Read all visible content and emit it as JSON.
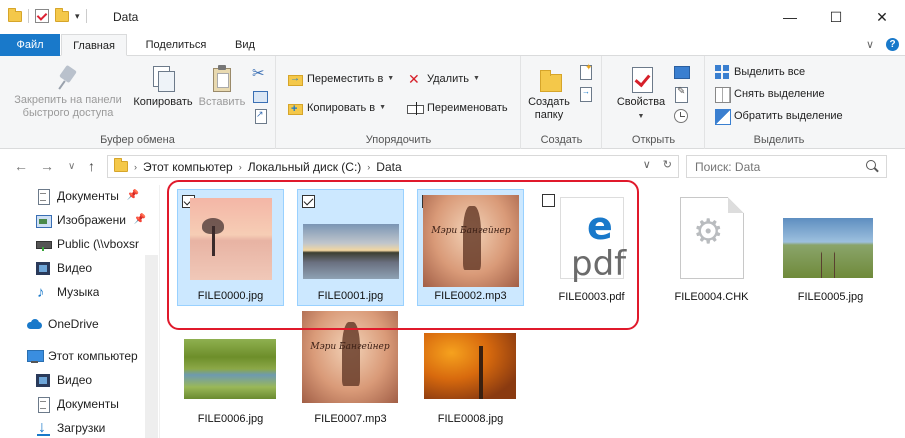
{
  "window": {
    "title": "Data",
    "controls": {
      "minimize": "—",
      "maximize": "☐",
      "close": "✕"
    }
  },
  "qat": {
    "dropdown": "▾"
  },
  "ribbon_tabs": [
    {
      "label": "Файл"
    },
    {
      "label": "Главная"
    },
    {
      "label": "Поделиться"
    },
    {
      "label": "Вид"
    }
  ],
  "ribbon_right": {
    "collapse": "∨",
    "help": "?"
  },
  "clipboard": {
    "pin": "Закрепить на панели быстрого доступа",
    "copy": "Копировать",
    "paste": "Вставить",
    "label": "Буфер обмена"
  },
  "organize": {
    "move": "Переместить в",
    "copy_to": "Копировать в",
    "delete": "Удалить",
    "rename": "Переименовать",
    "label": "Упорядочить"
  },
  "create": {
    "new_folder": "Создать папку",
    "label": "Создать"
  },
  "open": {
    "properties": "Свойства",
    "label": "Открыть"
  },
  "select": {
    "select_all": "Выделить все",
    "select_none": "Снять выделение",
    "invert": "Обратить выделение",
    "label": "Выделить"
  },
  "nav": {
    "back": "←",
    "forward": "→",
    "recent": "∨",
    "up": "↑"
  },
  "address": {
    "crumbs": [
      "Этот компьютер",
      "Локальный диск (C:)",
      "Data"
    ],
    "sep": "›",
    "dropdown": "∨",
    "refresh": "↻"
  },
  "search": {
    "placeholder": "Поиск: Data"
  },
  "sidebar": {
    "items": [
      {
        "label": "Документы",
        "pinned": "📌"
      },
      {
        "label": "Изображени",
        "pinned": "📌"
      },
      {
        "label": "Public (\\\\vboxsr"
      },
      {
        "label": "Видео"
      },
      {
        "label": "Музыка"
      },
      {
        "label": "OneDrive"
      },
      {
        "label": "Этот компьютер"
      },
      {
        "label": "Видео"
      },
      {
        "label": "Документы"
      },
      {
        "label": "Загрузки"
      }
    ]
  },
  "files": [
    {
      "name": "FILE0000.jpg",
      "selected": true,
      "checked": true
    },
    {
      "name": "FILE0001.jpg",
      "selected": true,
      "checked": true
    },
    {
      "name": "FILE0002.mp3",
      "selected": true,
      "checked": true,
      "art_title": "Мэри Бангейнер"
    },
    {
      "name": "FILE0003.pdf",
      "selected": false,
      "checked": false,
      "e_glyph": "e",
      "pdf_text": "pdf"
    },
    {
      "name": "FILE0004.CHK"
    },
    {
      "name": "FILE0005.jpg"
    },
    {
      "name": "FILE0006.jpg"
    },
    {
      "name": "FILE0007.mp3",
      "art_title": "Мэри Бангейнер"
    },
    {
      "name": "FILE0008.jpg"
    }
  ],
  "colors": {
    "accent": "#1979ca",
    "selection": "#cce8ff",
    "highlight": "#e0192b"
  }
}
